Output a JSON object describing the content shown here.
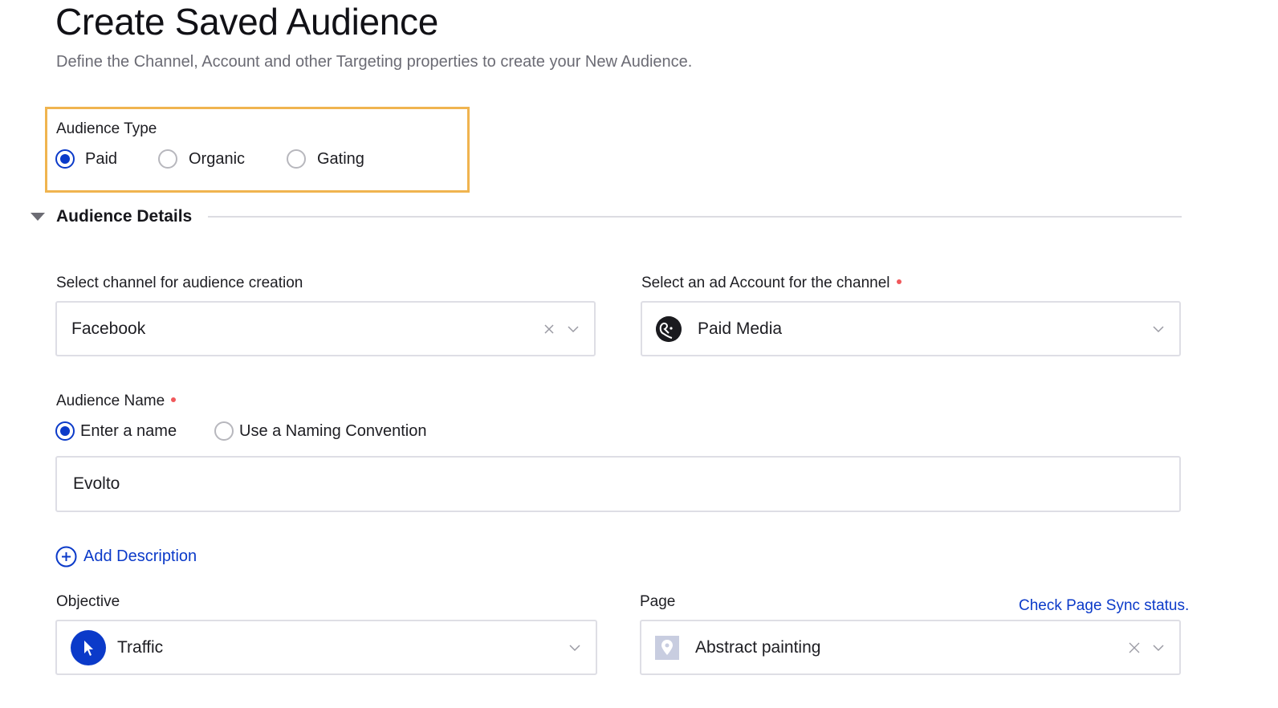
{
  "header": {
    "title": "Create Saved Audience",
    "subtitle": "Define the Channel, Account and other Targeting properties to create your New Audience."
  },
  "audience_type": {
    "label": "Audience Type",
    "options": [
      {
        "label": "Paid",
        "checked": true
      },
      {
        "label": "Organic",
        "checked": false
      },
      {
        "label": "Gating",
        "checked": false
      }
    ],
    "highlight_color": "#f0b44f"
  },
  "audience_details": {
    "section_title": "Audience Details",
    "expanded": true,
    "channel": {
      "label": "Select channel for audience creation",
      "value": "Facebook",
      "clear_icon": "close-icon",
      "dropdown_icon": "chevron-down-icon"
    },
    "ad_account": {
      "label": "Select an ad Account for the channel",
      "required": true,
      "value": "Paid Media",
      "avatar_icon": "account-avatar-icon",
      "dropdown_icon": "chevron-down-icon"
    },
    "audience_name": {
      "label": "Audience Name",
      "required": true,
      "options": [
        {
          "label": "Enter a name",
          "checked": true
        },
        {
          "label": "Use a Naming Convention",
          "checked": false
        }
      ],
      "value": "Evolto"
    },
    "add_description": {
      "label": "Add Description",
      "icon": "plus-circle-icon"
    },
    "objective": {
      "label": "Objective",
      "value": "Traffic",
      "icon": "cursor-icon",
      "dropdown_icon": "chevron-down-icon"
    },
    "page": {
      "label": "Page",
      "sync_link": "Check Page Sync status.",
      "value": "Abstract painting",
      "icon": "location-pin-icon",
      "clear_icon": "close-icon",
      "dropdown_icon": "chevron-down-icon"
    }
  },
  "colors": {
    "accent": "#0b3ac9",
    "required": "#f0585b",
    "border": "#dedee5"
  }
}
